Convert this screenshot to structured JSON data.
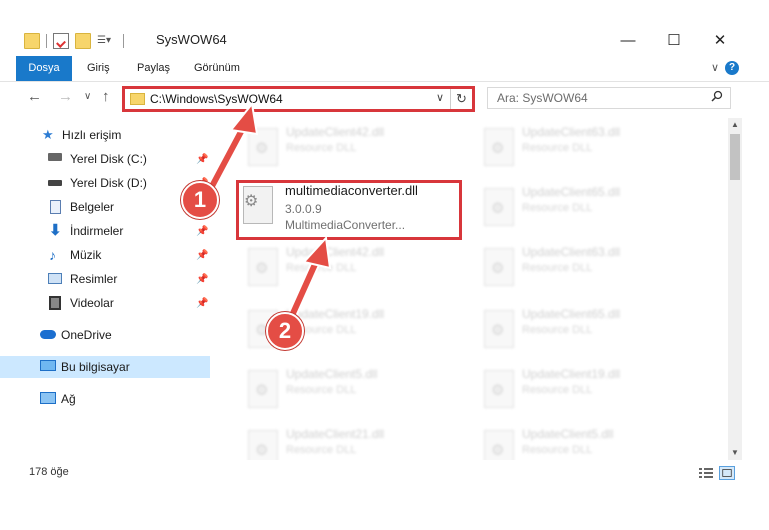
{
  "window": {
    "title": "SysWOW64",
    "minimize_glyph": "—",
    "maximize_glyph": "☐",
    "close_glyph": "✕"
  },
  "ribbon": {
    "tabs": [
      "Dosya",
      "Giriş",
      "Paylaş",
      "Görünüm"
    ],
    "help": "?",
    "collapse_glyph": "∨"
  },
  "nav": {
    "back_glyph": "←",
    "forward_glyph": "→",
    "recent_glyph": "∨",
    "up_glyph": "↑",
    "address_path": "C:\\Windows\\SysWOW64",
    "address_dropdown_glyph": "∨",
    "refresh_glyph": "↻",
    "search_placeholder": "Ara: SysWOW64"
  },
  "sidebar": {
    "items": [
      {
        "label": "Hızlı erişim",
        "icon": "star-icon",
        "pinned": false
      },
      {
        "label": "Yerel Disk (C:)",
        "icon": "drive-icon",
        "pinned": true
      },
      {
        "label": "Yerel Disk (D:)",
        "icon": "drive-icon",
        "pinned": true
      },
      {
        "label": "Belgeler",
        "icon": "documents-icon",
        "pinned": true
      },
      {
        "label": "İndirmeler",
        "icon": "download-icon",
        "pinned": true
      },
      {
        "label": "Müzik",
        "icon": "music-icon",
        "pinned": true
      },
      {
        "label": "Resimler",
        "icon": "pictures-icon",
        "pinned": true
      },
      {
        "label": "Videolar",
        "icon": "videos-icon",
        "pinned": true
      },
      {
        "label": "OneDrive",
        "icon": "cloud-icon",
        "pinned": false
      },
      {
        "label": "Bu bilgisayar",
        "icon": "computer-icon",
        "pinned": false,
        "selected": true
      },
      {
        "label": "Ağ",
        "icon": "network-icon",
        "pinned": false
      }
    ],
    "pin_glyph": "📌"
  },
  "files": {
    "highlighted": {
      "name": "multimediaconverter.dll",
      "version": "3.0.0.9",
      "description": "MultimediaConverter..."
    },
    "left_column": [
      {
        "name": "UpdateClient42.dll",
        "desc": "Resource DLL"
      },
      {
        "name": "UpdateClient42.dll",
        "desc": "Resource DLL"
      },
      {
        "name": "UpdateClient19.dll",
        "desc": "Resource DLL"
      },
      {
        "name": "UpdateClient5.dll",
        "desc": "Resource DLL"
      },
      {
        "name": "UpdateClient21.dll",
        "desc": "Resource DLL"
      }
    ],
    "right_column": [
      {
        "name": "UpdateClient63.dll",
        "desc": "Resource DLL"
      },
      {
        "name": "UpdateClient65.dll",
        "desc": "Resource DLL"
      },
      {
        "name": "UpdateClient63.dll",
        "desc": "Resource DLL"
      },
      {
        "name": "UpdateClient65.dll",
        "desc": "Resource DLL"
      },
      {
        "name": "UpdateClient19.dll",
        "desc": "Resource DLL"
      },
      {
        "name": "UpdateClient5.dll",
        "desc": "Resource DLL"
      }
    ]
  },
  "scrollbar": {
    "up_glyph": "▲",
    "down_glyph": "▼"
  },
  "status": {
    "item_count": "178 öğe"
  },
  "annotations": {
    "step1": "1",
    "step2": "2",
    "color": "#e44d45"
  }
}
